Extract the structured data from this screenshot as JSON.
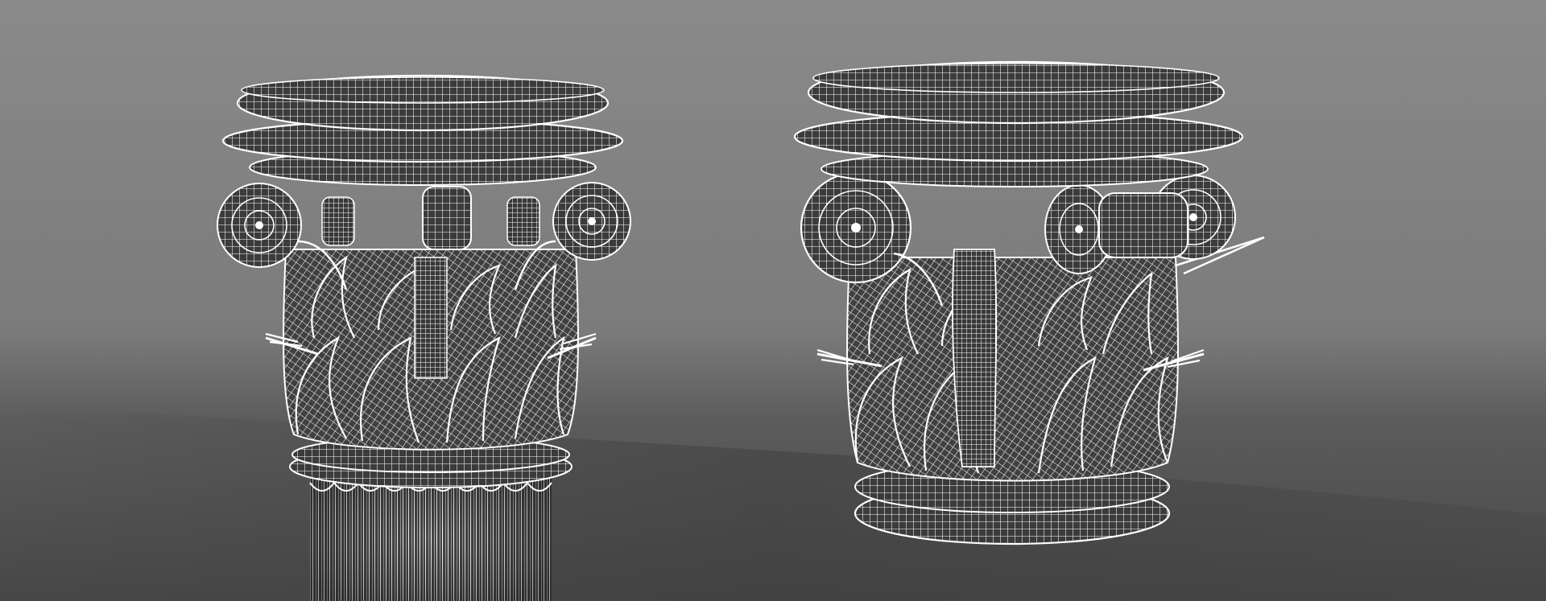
{
  "scene": {
    "background_top": "#878787",
    "background_mid": "#7c7c7c",
    "floor_color": "#4a4a4a",
    "wire_color": "#ffffff",
    "shade_color": "#3a3a3a"
  },
  "objects": [
    {
      "name": "corinthian-capital-with-shaft-wireframe"
    },
    {
      "name": "corinthian-capital-wireframe"
    }
  ]
}
